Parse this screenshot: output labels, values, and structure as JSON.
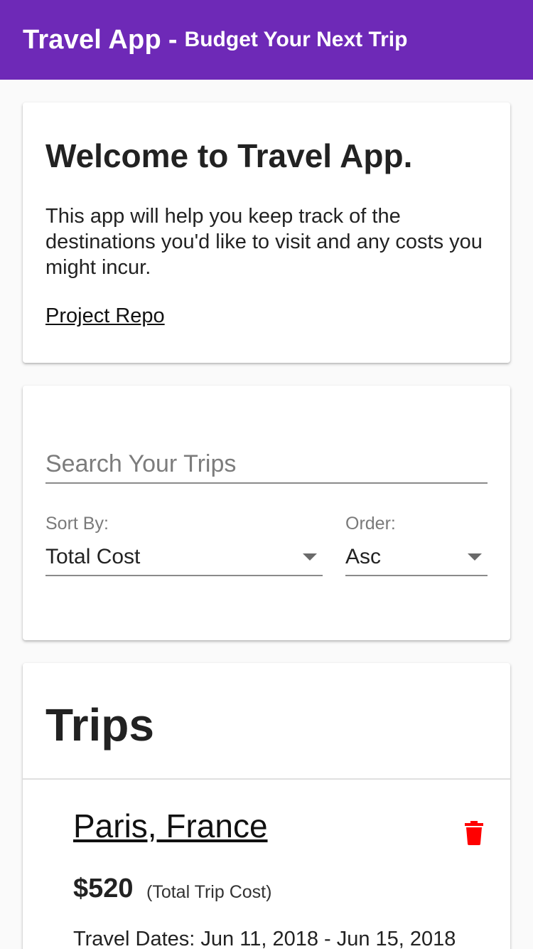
{
  "appbar": {
    "title": "Travel App",
    "separator": "-",
    "subtitle": "Budget Your Next Trip",
    "color": "#6e29b7"
  },
  "welcome": {
    "heading": "Welcome to Travel App.",
    "body": "This app will help you keep track of the destinations you'd like to visit and any costs you might incur.",
    "link_label": "Project Repo"
  },
  "search": {
    "placeholder": "Search Your Trips",
    "value": "",
    "sort_by_label": "Sort By:",
    "sort_by_value": "Total Cost",
    "order_label": "Order:",
    "order_value": "Asc"
  },
  "trips": {
    "heading": "Trips",
    "items": [
      {
        "name": "Paris, France",
        "cost": "$520",
        "cost_label": "(Total Trip Cost)",
        "dates": "Travel Dates: Jun 11, 2018 - Jun 15, 2018",
        "delete_icon": "trash-icon",
        "delete_color": "#ff0000"
      }
    ]
  }
}
